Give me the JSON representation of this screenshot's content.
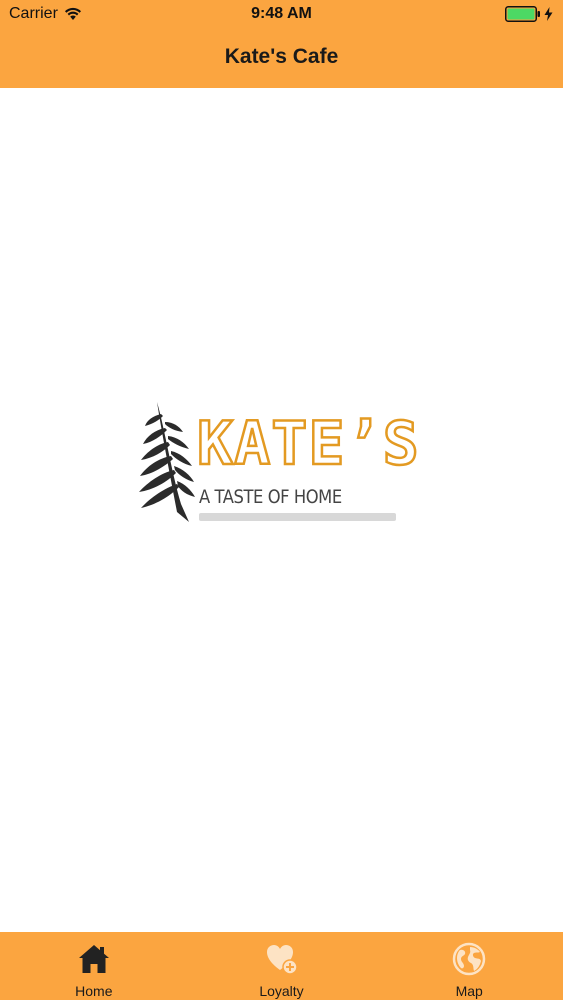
{
  "status_bar": {
    "carrier": "Carrier",
    "time": "9:48 AM",
    "battery_color": "#4CD964"
  },
  "nav": {
    "title": "Kate's Cafe"
  },
  "logo": {
    "name": "KATE’S",
    "tagline": "A TASTE OF HOME",
    "name_color": "#E39A22"
  },
  "tabs": [
    {
      "label": "Home",
      "icon": "home-icon",
      "selected": true
    },
    {
      "label": "Loyalty",
      "icon": "heart-plus-icon",
      "selected": false
    },
    {
      "label": "Map",
      "icon": "globe-icon",
      "selected": false
    }
  ],
  "colors": {
    "accent": "#FBA540",
    "selected_icon": "#222222",
    "unselected_icon": "#FDE3C4"
  }
}
